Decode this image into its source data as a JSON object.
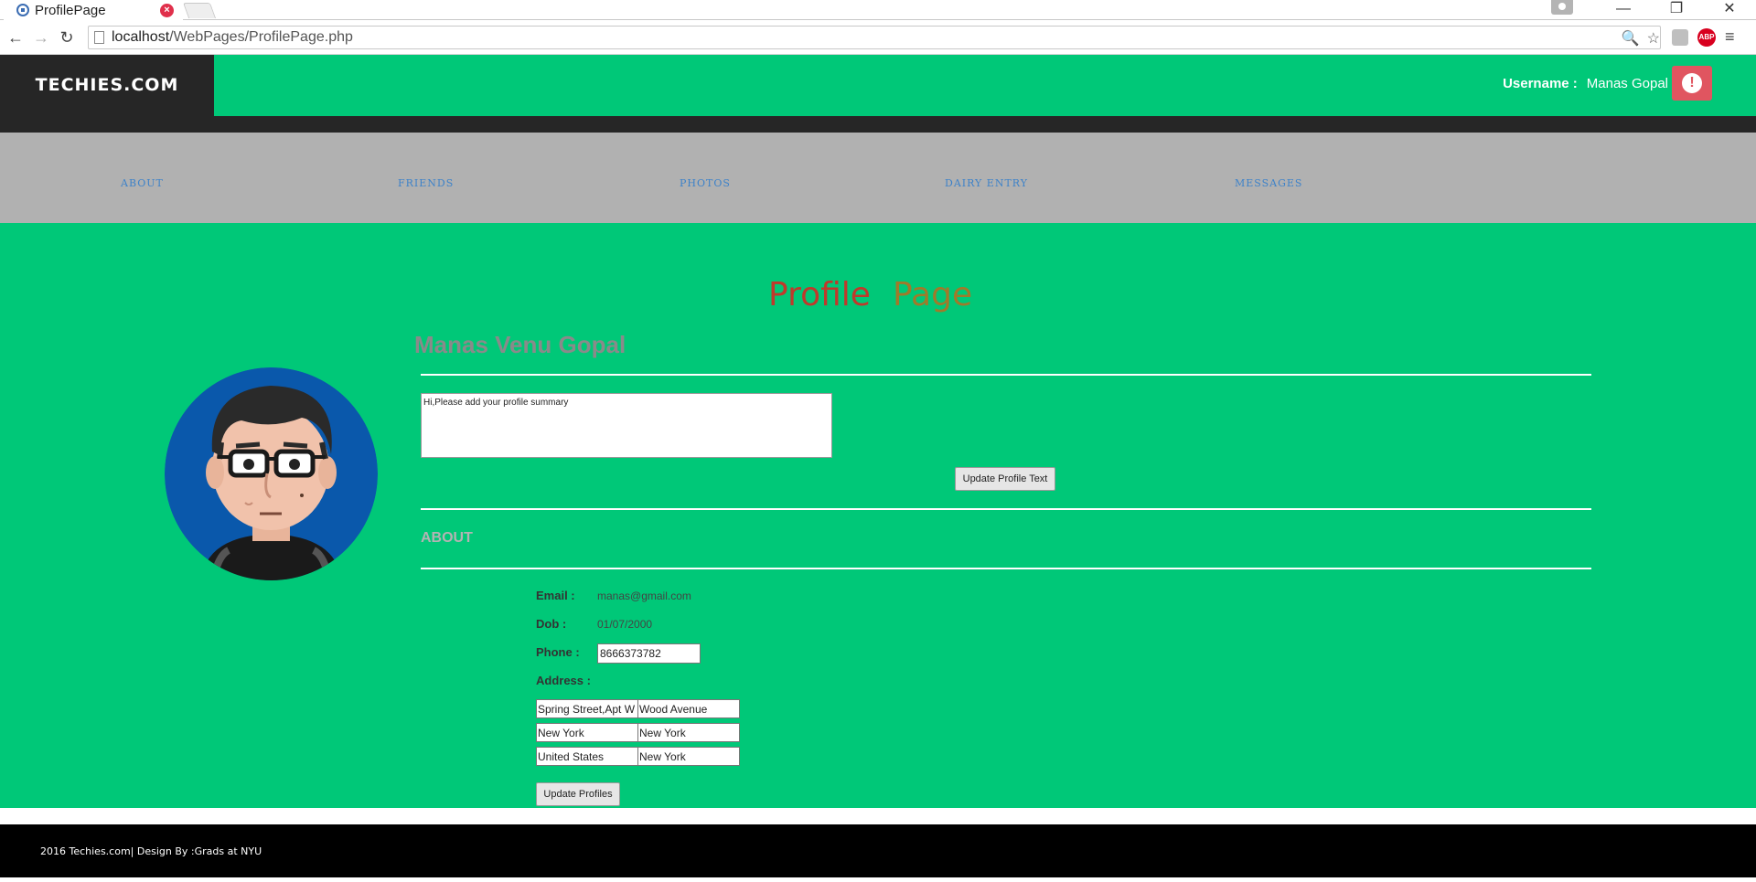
{
  "browser": {
    "tab_title": "ProfilePage",
    "tab_close_glyph": "×",
    "url_host": "localhost",
    "url_path": "/WebPages/ProfilePage.php",
    "extensions": {
      "abp_label": "ABP"
    },
    "window_controls": {
      "minimize": "—",
      "restore": "❐",
      "close": "✕"
    },
    "nav": {
      "back": "←",
      "forward": "→",
      "reload": "↻"
    },
    "omnibox_icons": {
      "zoom": "🔍",
      "star": "☆"
    },
    "menu_glyph": "≡"
  },
  "site": {
    "brand": "TECHIES.COM",
    "username_label": "Username :",
    "username": "Manas Gopal",
    "alert_glyph": "!"
  },
  "nav_links": [
    "ABOUT",
    "FRIENDS",
    "PHOTOS",
    "DAIRY ENTRY",
    "MESSAGES"
  ],
  "profile": {
    "title_part1": "Profile",
    "title_part2": "Page",
    "full_name": "Manas Venu Gopal",
    "summary": "Hi,Please add your profile summary",
    "update_text_button": "Update Profile Text",
    "about_heading": "ABOUT",
    "email_label": "Email :",
    "email": "manas@gmail.com",
    "dob_label": "Dob :",
    "dob": "01/07/2000",
    "phone_label": "Phone :",
    "phone": "8666373782",
    "address_label": "Address :",
    "address": {
      "line1": "Spring Street,Apt W",
      "line2": "Wood Avenue",
      "city": "New York",
      "state": "New York",
      "country": "United States",
      "region": "New York"
    },
    "update_profiles_button": "Update Profiles"
  },
  "footer": {
    "text": "2016 Techies.com| Design By :Grads at NYU"
  },
  "colors": {
    "primary_green": "#00c878",
    "dark": "#262626",
    "nav_gray": "#b1b1b1",
    "nav_link": "#3d82c9",
    "alert_red": "#e05560"
  }
}
